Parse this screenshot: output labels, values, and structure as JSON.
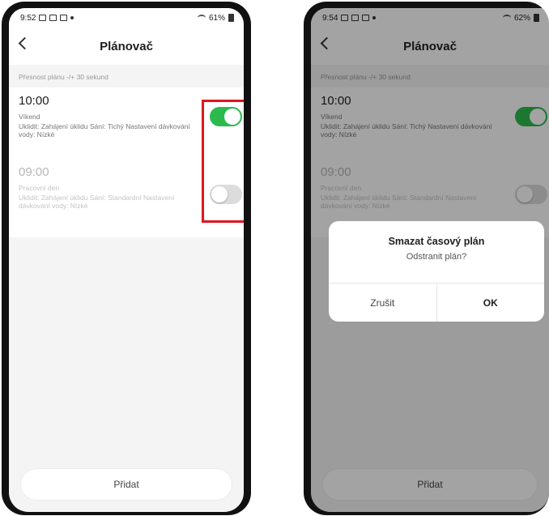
{
  "left": {
    "status": {
      "time": "9:52",
      "battery": "61%"
    },
    "header": {
      "title": "Plánovač"
    },
    "accuracy_note": "Přesnost plánu -/+ 30 sekund",
    "schedules": [
      {
        "time": "10:00",
        "days": "Víkend",
        "description": "Uklidit: Zahájení úklidu Sání: Tichý Nastavení dávkování vody: Nízké",
        "enabled": true
      },
      {
        "time": "09:00",
        "days": "Pracovní den",
        "description": "Uklidit: Zahájení úklidu Sání: Standardní Nastavení dávkování vody: Nízké",
        "enabled": false
      }
    ],
    "add_label": "Přidat"
  },
  "right": {
    "status": {
      "time": "9:54",
      "battery": "62%"
    },
    "header": {
      "title": "Plánovač"
    },
    "accuracy_note": "Přesnost plánu -/+ 30 sekund",
    "schedules": [
      {
        "time": "10:00",
        "days": "Víkend",
        "description": "Uklidit: Zahájení úklidu Sání: Tichý Nastavení dávkování vody: Nízké",
        "enabled": true
      },
      {
        "time": "09:00",
        "days": "Pracovní den",
        "description": "Uklidit: Zahájení úklidu Sání: Standardní Nastavení dávkování vody: Nízké",
        "enabled": false
      }
    ],
    "add_label": "Přidat",
    "dialog": {
      "title": "Smazat časový plán",
      "message": "Odstranit plán?",
      "cancel_label": "Zrušit",
      "ok_label": "OK"
    }
  },
  "colors": {
    "toggle_on": "#2cba4e",
    "toggle_off": "#dcdcdc",
    "highlight": "#e0161f"
  },
  "icons": [
    "back-chevron-icon",
    "wifi-icon",
    "battery-icon",
    "notification-icon"
  ]
}
